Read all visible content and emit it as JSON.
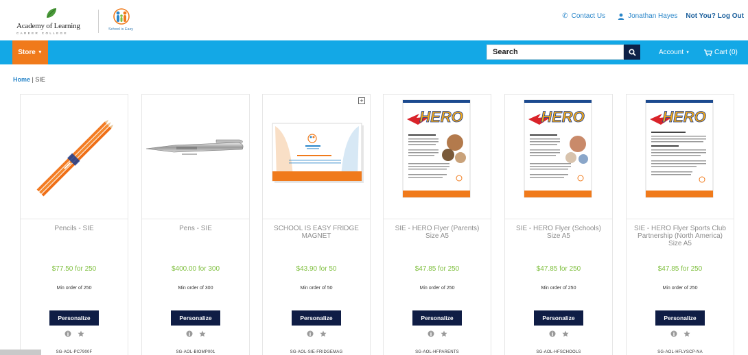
{
  "header": {
    "brand_name": "Academy of Learning",
    "brand_tagline": "CAREER COLLEGE",
    "partner_caption": "School is Easy",
    "contact_label": "Contact Us",
    "user_name": "Jonathan Hayes",
    "logout_label": "Not You? Log Out"
  },
  "nav": {
    "store_label": "Store",
    "search_placeholder": "Search",
    "account_label": "Account",
    "cart_label": "Cart (0)"
  },
  "breadcrumb": {
    "home": "Home",
    "separator": " | ",
    "current": "SIE"
  },
  "colors": {
    "nav_blue": "#13a8e6",
    "store_orange": "#f07a1b",
    "button_navy": "#0f1d45",
    "price_green": "#7fbf3f",
    "link_blue": "#2a86c9"
  },
  "products": [
    {
      "title": "Pencils - SIE",
      "price": "$77.50 for 250",
      "min_order": "Min order of 250",
      "button": "Personalize",
      "sku": "SG-AOL-PC7900F",
      "image": "pencils"
    },
    {
      "title": "Pens - SIE",
      "price": "$400.00 for 300",
      "min_order": "Min order of 300",
      "button": "Personalize",
      "sku": "SG-AOL-BIOMP001",
      "image": "pen"
    },
    {
      "title": "SCHOOL IS EASY FRIDGE MAGNET",
      "price": "$43.90 for 50",
      "min_order": "Min order of 50",
      "button": "Personalize",
      "sku": "SG-AOL-SIE-FRIDGEMAG",
      "image": "magnet"
    },
    {
      "title": "SIE - HERO Flyer (Parents) Size A5",
      "price": "$47.85 for 250",
      "min_order": "Min order of 250",
      "button": "Personalize",
      "sku": "SG-AOL-HFPARENTS",
      "image": "flyer"
    },
    {
      "title": "SIE - HERO Flyer (Schools) Size A5",
      "price": "$47.85 for 250",
      "min_order": "Min order of 250",
      "button": "Personalize",
      "sku": "SG-AOL-HFSCHOOLS",
      "image": "flyer"
    },
    {
      "title": "SIE - HERO Flyer Sports Club Partnership (North America) Size A5",
      "price": "$47.85 for 250",
      "min_order": "Min order of 250",
      "button": "Personalize",
      "sku": "SG-AOL-HFLYSCP-NA",
      "image": "flyer"
    }
  ]
}
